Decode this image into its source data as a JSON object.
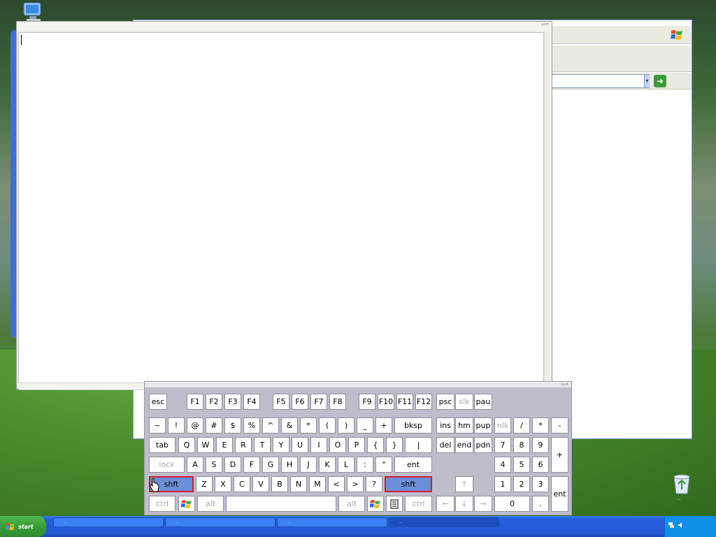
{
  "desktop": {
    "icons": [
      {
        "name": "My Computer"
      },
      {
        "name": "Recycle Bin",
        "caption": "..."
      }
    ]
  },
  "browser": {
    "address_dropdown": "▾",
    "go_arrow": "➜"
  },
  "notepad": {
    "title": "",
    "menu": "",
    "text": ""
  },
  "osk": {
    "title": "",
    "rows": {
      "fn": [
        "esc",
        "F1",
        "F2",
        "F3",
        "F4",
        "F5",
        "F6",
        "F7",
        "F8",
        "F9",
        "F10",
        "F11",
        "F12",
        "psc",
        "slk",
        "pau"
      ],
      "num": [
        "~",
        "!",
        "@",
        "#",
        "$",
        "%",
        "^",
        "&",
        "*",
        "(",
        ")",
        "_",
        "+",
        "bksp",
        "ins",
        "hm",
        "pup",
        "nlk",
        "/",
        "*",
        "-"
      ],
      "top": [
        "tab",
        "Q",
        "W",
        "E",
        "R",
        "T",
        "Y",
        "U",
        "I",
        "O",
        "P",
        "{",
        "}",
        "|",
        "del",
        "end",
        "pdn",
        "7",
        "8",
        "9",
        "+"
      ],
      "home": [
        "lock",
        "A",
        "S",
        "D",
        "F",
        "G",
        "H",
        "J",
        "K",
        "L",
        ":",
        "\"",
        "ent",
        "4",
        "5",
        "6"
      ],
      "shift": [
        "shft",
        "Z",
        "X",
        "C",
        "V",
        "B",
        "N",
        "M",
        "<",
        ">",
        "?",
        "shft",
        "↑",
        "1",
        "2",
        "3",
        "ent"
      ],
      "bottom": [
        "ctrl",
        "alt",
        "alt",
        "ctrl",
        "←",
        "↓",
        "→",
        "0",
        "."
      ]
    }
  },
  "taskbar": {
    "start_label": "start",
    "tasks": [
      "...",
      "...",
      "...",
      "..."
    ]
  },
  "colors": {
    "xp_blue": "#245edb",
    "start_green": "#3a9e3a",
    "key_selected": "#6a8fd6",
    "key_selected_border": "#d21c2c"
  }
}
